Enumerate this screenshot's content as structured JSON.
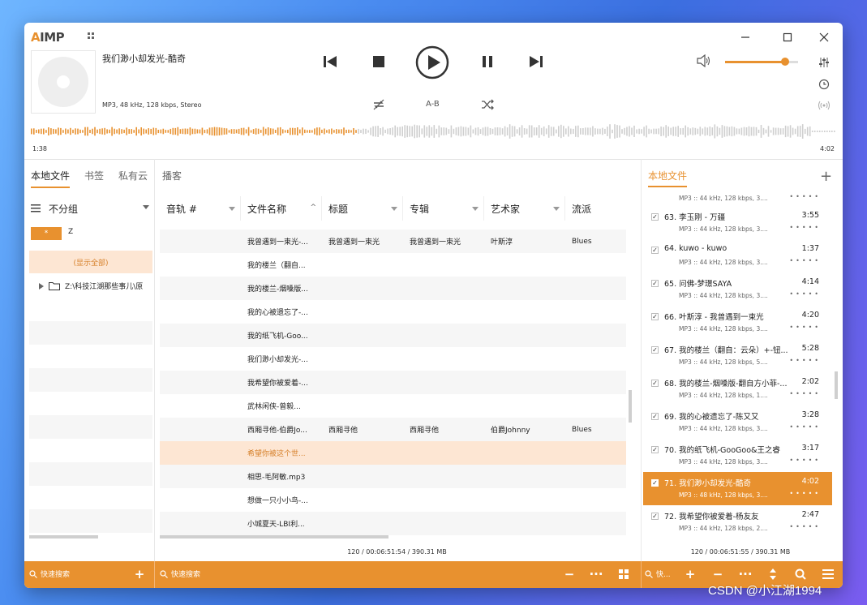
{
  "app": {
    "logo_prefix": "A",
    "logo_rest": "IMP"
  },
  "now_playing": {
    "title": "我们渺小却发光-酷奇",
    "info": "MP3, 48 kHz, 128 kbps, Stereo",
    "time_elapsed": "1:38",
    "time_total": "4:02",
    "progress": 0.405,
    "volume": 0.82
  },
  "controls": {
    "ab_label": "A-B"
  },
  "tabs": [
    "本地文件",
    "书签",
    "私有云",
    "播客"
  ],
  "group": {
    "label": "不分组",
    "star": "*",
    "z": "Z",
    "show_all": "(显示全部)",
    "folder": "Z:\\科技江湖那些事儿\\原"
  },
  "table": {
    "columns": [
      "音轨 #",
      "文件名称",
      "标题",
      "专辑",
      "艺术家",
      "流派"
    ],
    "rows": [
      [
        "",
        "我曾遇到一束光-...",
        "我曾遇到一束光",
        "我曾遇到一束光",
        "叶斯淳",
        "Blues"
      ],
      [
        "",
        "我的楼兰（翻自...",
        "",
        "",
        "",
        ""
      ],
      [
        "",
        "我的楼兰-烟嗓版...",
        "",
        "",
        "",
        ""
      ],
      [
        "",
        "我的心被遗忘了-...",
        "",
        "",
        "",
        ""
      ],
      [
        "",
        "我的纸飞机-Goo...",
        "",
        "",
        "",
        ""
      ],
      [
        "",
        "我们渺小却发光-...",
        "",
        "",
        "",
        ""
      ],
      [
        "",
        "我希望你被爱着-...",
        "",
        "",
        "",
        ""
      ],
      [
        "",
        "武林闲侠-曾毅...",
        "",
        "",
        "",
        ""
      ],
      [
        "",
        "西厢寻他-伯爵Jo...",
        "西厢寻他",
        "西厢寻他",
        "伯爵Johnny",
        "Blues"
      ],
      [
        "",
        "希望你被这个世...",
        "",
        "",
        "",
        ""
      ],
      [
        "",
        "相思-毛阿敏.mp3",
        "",
        "",
        "",
        ""
      ],
      [
        "",
        "想做一只小小鸟-...",
        "",
        "",
        "",
        ""
      ],
      [
        "",
        "小城夏天-LBI利...",
        "",
        "",
        "",
        ""
      ]
    ],
    "status": "120 / 00:06:51:54 / 390.31 MB"
  },
  "playlist": {
    "title": "本地文件",
    "partial_meta": "MP3 :: 44 kHz, 128 kbps, 3....",
    "items": [
      {
        "title": "63. 李玉刚 - 万疆",
        "dur": "3:55",
        "meta": "MP3 :: 44 kHz, 128 kbps, 3...."
      },
      {
        "title": "64. kuwo - kuwo",
        "dur": "1:37",
        "meta": "MP3 :: 44 kHz, 128 kbps, 3...."
      },
      {
        "title": "65. 问佛-梦璟SAYA",
        "dur": "4:14",
        "meta": "MP3 :: 44 kHz, 128 kbps, 3...."
      },
      {
        "title": "66. 叶斯淳 - 我曾遇到一束光",
        "dur": "4:20",
        "meta": "MP3 :: 44 kHz, 128 kbps, 3...."
      },
      {
        "title": "67. 我的楼兰（翻自：云朵）+-钮...",
        "dur": "5:28",
        "meta": "MP3 :: 44 kHz, 128 kbps, 5...."
      },
      {
        "title": "68. 我的楼兰-烟嗓版-翻自方小菲-...",
        "dur": "2:02",
        "meta": "MP3 :: 44 kHz, 128 kbps, 1...."
      },
      {
        "title": "69. 我的心被遗忘了-陈又又",
        "dur": "3:28",
        "meta": "MP3 :: 44 kHz, 128 kbps, 3...."
      },
      {
        "title": "70. 我的纸飞机-GooGoo&王之睿",
        "dur": "3:17",
        "meta": "MP3 :: 44 kHz, 128 kbps, 3...."
      },
      {
        "title": "71. 我们渺小却发光-酷奇",
        "dur": "4:02",
        "meta": "MP3 :: 48 kHz, 128 kbps, 3...."
      },
      {
        "title": "72. 我希望你被爱着-杨友友",
        "dur": "2:47",
        "meta": "MP3 :: 44 kHz, 128 kbps, 2...."
      }
    ],
    "status": "120 / 00:06:51:55 / 390.31 MB"
  },
  "bottom": {
    "search1": "快速搜索",
    "search2": "快速搜索",
    "search3": "快..."
  },
  "watermark": "CSDN @小江湖1994",
  "colors": {
    "accent": "#e8912f",
    "selection": "#fde6d3"
  }
}
